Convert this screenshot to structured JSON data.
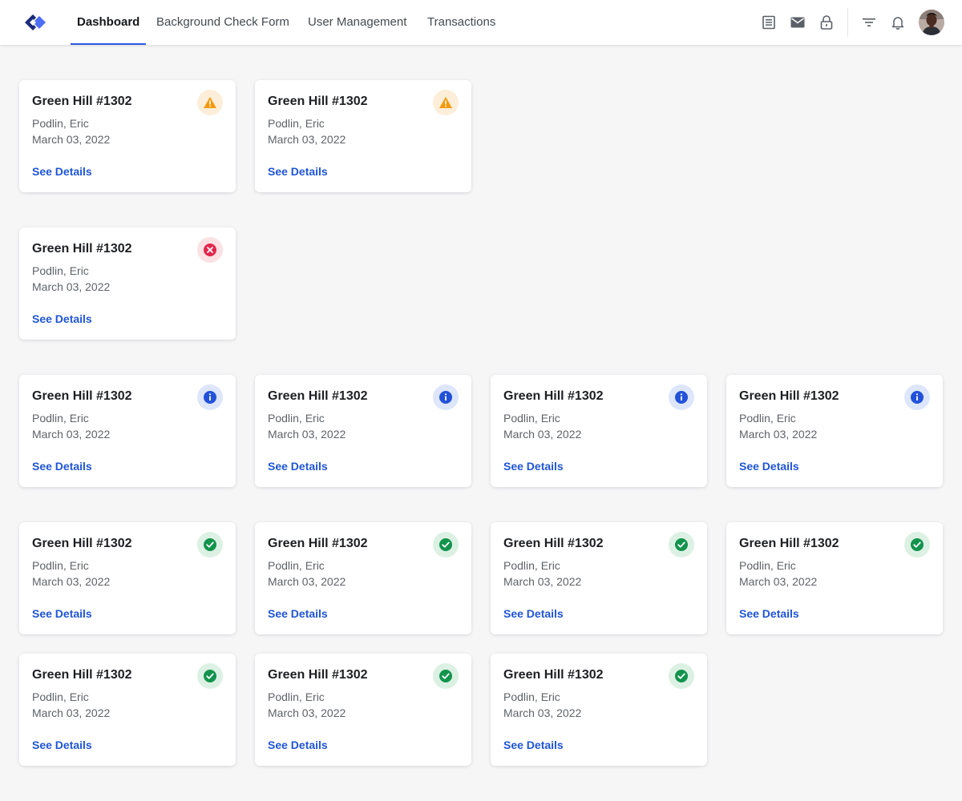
{
  "nav": {
    "tabs": [
      "Dashboard",
      "Background Check Form",
      "User Management",
      "Transactions"
    ],
    "active_tab": "Dashboard"
  },
  "toolbar_icons": [
    "list-icon",
    "mail-icon",
    "lock-icon",
    "filter-icon",
    "bell-icon"
  ],
  "colors": {
    "accent": "#2b59e0",
    "link": "#1f55d6",
    "warning": "#f29a0a",
    "error": "#e3264a",
    "info": "#2252d9",
    "success": "#13934d"
  },
  "cards": [
    {
      "title": "Green Hill #1302",
      "name": "Podlin, Eric",
      "date": "March 03, 2022",
      "link": "See Details",
      "status": "warning"
    },
    {
      "title": "Green Hill #1302",
      "name": "Podlin, Eric",
      "date": "March 03, 2022",
      "link": "See Details",
      "status": "warning"
    },
    {
      "title": "Green Hill #1302",
      "name": "Podlin, Eric",
      "date": "March 03, 2022",
      "link": "See Details",
      "status": "error"
    },
    {
      "title": "Green Hill #1302",
      "name": "Podlin, Eric",
      "date": "March 03, 2022",
      "link": "See Details",
      "status": "info"
    },
    {
      "title": "Green Hill #1302",
      "name": "Podlin, Eric",
      "date": "March 03, 2022",
      "link": "See Details",
      "status": "info"
    },
    {
      "title": "Green Hill #1302",
      "name": "Podlin, Eric",
      "date": "March 03, 2022",
      "link": "See Details",
      "status": "info"
    },
    {
      "title": "Green Hill #1302",
      "name": "Podlin, Eric",
      "date": "March 03, 2022",
      "link": "See Details",
      "status": "info"
    },
    {
      "title": "Green Hill #1302",
      "name": "Podlin, Eric",
      "date": "March 03, 2022",
      "link": "See Details",
      "status": "success"
    },
    {
      "title": "Green Hill #1302",
      "name": "Podlin, Eric",
      "date": "March 03, 2022",
      "link": "See Details",
      "status": "success"
    },
    {
      "title": "Green Hill #1302",
      "name": "Podlin, Eric",
      "date": "March 03, 2022",
      "link": "See Details",
      "status": "success"
    },
    {
      "title": "Green Hill #1302",
      "name": "Podlin, Eric",
      "date": "March 03, 2022",
      "link": "See Details",
      "status": "success"
    },
    {
      "title": "Green Hill #1302",
      "name": "Podlin, Eric",
      "date": "March 03, 2022",
      "link": "See Details",
      "status": "success"
    },
    {
      "title": "Green Hill #1302",
      "name": "Podlin, Eric",
      "date": "March 03, 2022",
      "link": "See Details",
      "status": "success"
    },
    {
      "title": "Green Hill #1302",
      "name": "Podlin, Eric",
      "date": "March 03, 2022",
      "link": "See Details",
      "status": "success"
    }
  ]
}
